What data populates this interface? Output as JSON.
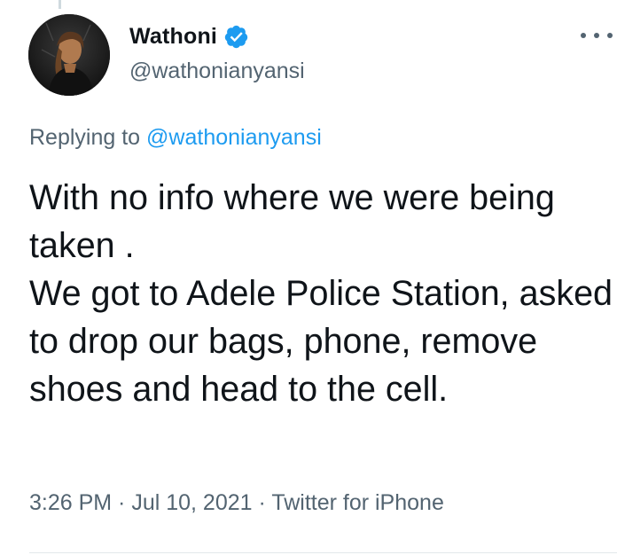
{
  "author": {
    "display_name": "Wathoni",
    "handle": "@wathonianyansi",
    "verified": true,
    "verified_color": "#1d9bf0"
  },
  "more_menu": {
    "icon": "more-horizontal-icon"
  },
  "replying": {
    "prefix": "Replying to ",
    "mention": "@wathonianyansi"
  },
  "tweet": {
    "text": "With no info where we were being taken .\nWe got to Adele Police Station, asked to drop our bags, phone, remove shoes and head to the cell."
  },
  "meta": {
    "time": "3:26 PM",
    "separator": " · ",
    "date": "Jul 10, 2021",
    "source": "Twitter for iPhone"
  },
  "colors": {
    "text": "#0f1419",
    "secondary": "#536471",
    "link": "#1d9bf0"
  }
}
